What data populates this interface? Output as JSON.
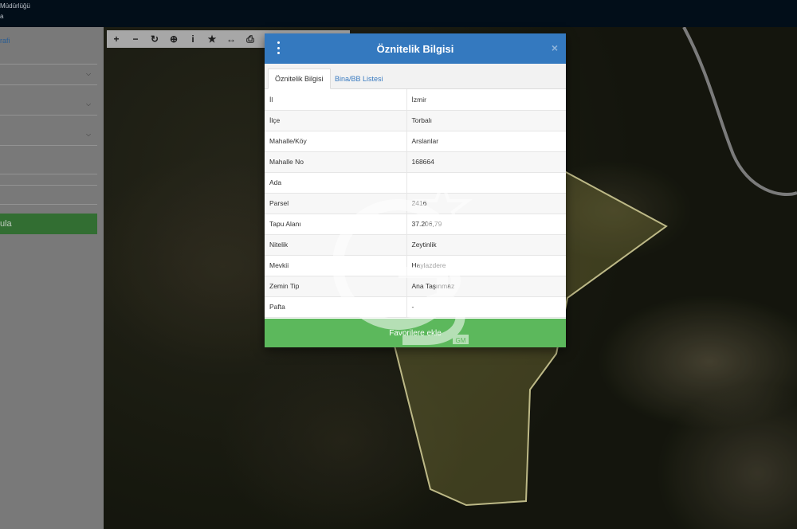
{
  "app": {
    "title_line1": "Müdürlüğü",
    "title_line2": "a"
  },
  "sidebar": {
    "link": "rafi",
    "button": "ula"
  },
  "toolbar": {
    "buttons": [
      {
        "name": "zoom-in-icon",
        "glyph": "+"
      },
      {
        "name": "zoom-out-icon",
        "glyph": "−"
      },
      {
        "name": "refresh-icon",
        "glyph": "↻"
      },
      {
        "name": "locate-icon",
        "glyph": "⊕"
      },
      {
        "name": "info-icon",
        "glyph": "i"
      },
      {
        "name": "star-icon",
        "glyph": "★"
      },
      {
        "name": "measure-icon",
        "glyph": "↔"
      },
      {
        "name": "print-icon",
        "glyph": "⎙"
      }
    ]
  },
  "modal": {
    "title": "Öznitelik Bilgisi",
    "close": "×",
    "tabs": [
      "Öznitelik Bilgisi",
      "Bina/BB Listesi"
    ],
    "rows": [
      {
        "key": "İl",
        "value": "İzmir"
      },
      {
        "key": "İlçe",
        "value": "Torbalı"
      },
      {
        "key": "Mahalle/Köy",
        "value": "Arslanlar"
      },
      {
        "key": "Mahalle No",
        "value": "168664"
      },
      {
        "key": "Ada",
        "value": ""
      },
      {
        "key": "Parsel",
        "value": "2416"
      },
      {
        "key": "Tapu Alanı",
        "value": "37.206,79"
      },
      {
        "key": "Nitelik",
        "value": "Zeytinlik"
      },
      {
        "key": "Mevkii",
        "value": "Haylazdere"
      },
      {
        "key": "Zemin Tip",
        "value": "Ana Taşınmaz"
      },
      {
        "key": "Pafta",
        "value": "-"
      }
    ],
    "favorites_button": "Favorilere ekle"
  },
  "watermark": {
    "text": "GB",
    "small": "GM"
  },
  "colors": {
    "header_blue": "#3479bf",
    "favorites_green": "#5cb85c",
    "parcel_outline": "#d8d39a"
  }
}
